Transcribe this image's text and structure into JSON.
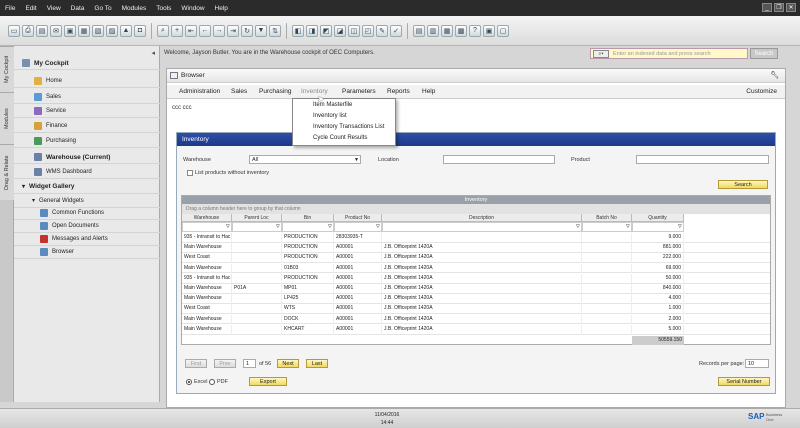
{
  "menubar": {
    "items": [
      "File",
      "Edit",
      "View",
      "Data",
      "Go To",
      "Modules",
      "Tools",
      "Window",
      "Help"
    ]
  },
  "sidetabs": [
    "My Cockpit",
    "Modules",
    "Drag & Relate"
  ],
  "leftpanel": {
    "cockpit_title": "My Cockpit",
    "cockpit_items": [
      "Home",
      "Sales",
      "Service",
      "Finance",
      "Purchasing"
    ],
    "warehouse_current": "Warehouse (Current)",
    "wms_dashboard": "WMS Dashboard",
    "widget_gallery": "Widget Gallery",
    "general_widgets": "General Widgets",
    "widgets": [
      "Common Functions",
      "Open Documents",
      "Messages and Alerts",
      "Browser"
    ]
  },
  "welcome": "Welcome, Jayson Butler. You are in the Warehouse cockpit of OEC Computers.",
  "search": {
    "placeholder": "Enter an indexed data and press search",
    "button": "Search"
  },
  "browser": {
    "title": "Browser",
    "tabs": [
      "Administration",
      "Sales",
      "Purchasing",
      "Inventory",
      "Parameters",
      "Reports",
      "Help"
    ],
    "customize": "Customize",
    "crumb": "ccc ccc",
    "dropdown": [
      "Item Masterfile",
      "Inventory list",
      "Inventory Transactions List",
      "Cycle Count Results"
    ]
  },
  "inventory": {
    "title": "Inventory",
    "warehouse_label": "Warehouse",
    "warehouse_value": "All",
    "location_label": "Location",
    "product_label": "Product",
    "checkbox_label": "List products without inventory",
    "search_button": "Search",
    "grid_caption": "Inventory",
    "drag_hint": "Drag a column header here to group by that column",
    "columns": [
      "Warehouse",
      "Parent Loc",
      "Bin",
      "Product No",
      "Description",
      "Batch No",
      "Quantity"
    ],
    "rows": [
      [
        "935 - Intransit to Hac",
        "",
        "PRODUCTION",
        "28303935-T",
        "",
        "",
        "9.000"
      ],
      [
        "Main Warehouse",
        "",
        "PRODUCTION",
        "A00001",
        "J.B. Officeprint 1420A",
        "",
        "881.000"
      ],
      [
        "West Coast",
        "",
        "PRODUCTION",
        "A00001",
        "J.B. Officeprint 1420A",
        "",
        "222.000"
      ],
      [
        "Main Warehouse",
        "",
        "01B03",
        "A00001",
        "J.B. Officeprint 1420A",
        "",
        "69.000"
      ],
      [
        "935 - Intransit to Hac",
        "",
        "PRODUCTION",
        "A00001",
        "J.B. Officeprint 1420A",
        "",
        "50.000"
      ],
      [
        "Main Warehouse",
        "P01A",
        "MP01",
        "A00001",
        "J.B. Officeprint 1420A",
        "",
        "840.000"
      ],
      [
        "Main Warehouse",
        "",
        "LP425",
        "A00001",
        "J.B. Officeprint 1420A",
        "",
        "4.000"
      ],
      [
        "West Coast",
        "",
        "WTS",
        "A00001",
        "J.B. Officeprint 1420A",
        "",
        "1.000"
      ],
      [
        "Main Warehouse",
        "",
        "DOCK",
        "A00001",
        "J.B. Officeprint 1420A",
        "",
        "2.000"
      ],
      [
        "Main Warehouse",
        "",
        "KHCART",
        "A00001",
        "J.B. Officeprint 1420A",
        "",
        "5.000"
      ]
    ],
    "total": "50559.150",
    "pager": {
      "first": "First",
      "prev": "Prev",
      "page": "1",
      "of": "of 56",
      "next": "Next",
      "last": "Last"
    },
    "records_label": "Records per page:",
    "records_value": "10",
    "export_options": [
      "Excel",
      "PDF"
    ],
    "export_button": "Export",
    "serial_button": "Serial Number"
  },
  "statusbar": {
    "date": "11/04/2016",
    "time": "14:44"
  },
  "brand": {
    "logo_text": "SAP",
    "tagline": "Business One"
  }
}
